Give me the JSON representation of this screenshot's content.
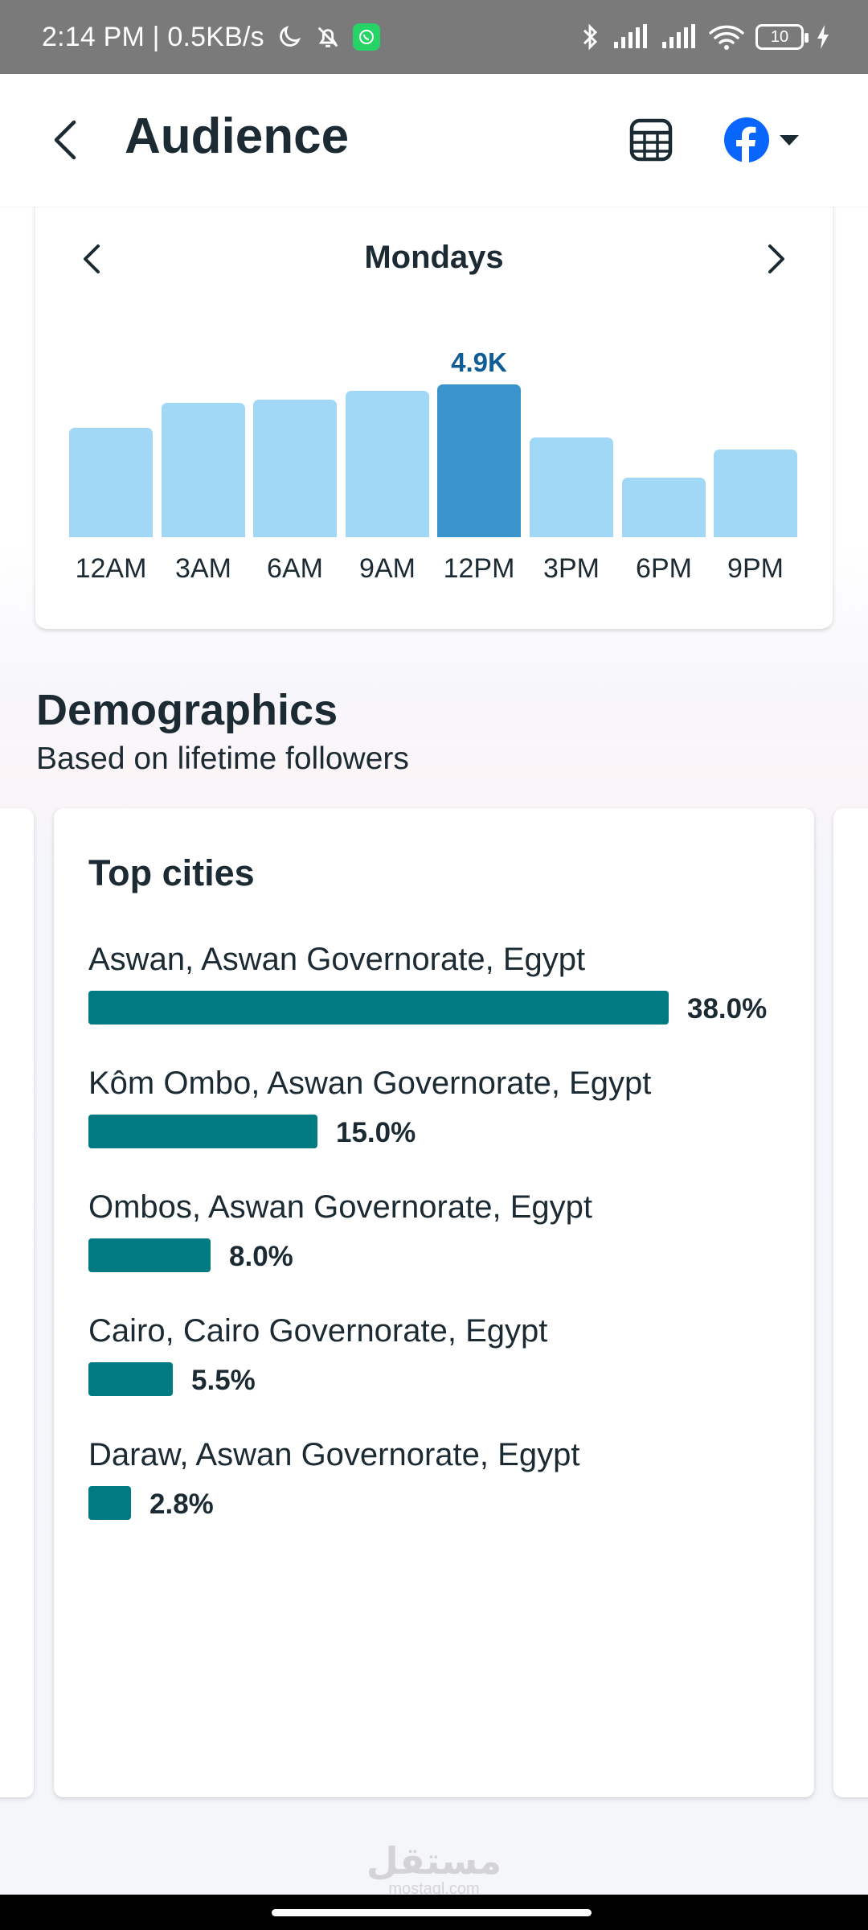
{
  "status_bar": {
    "time_and_speed": "2:14 PM | 0.5KB/s",
    "battery": "10"
  },
  "header": {
    "title": "Audience",
    "back_icon": "chevron-left-icon",
    "table_icon": "table-icon",
    "account_icon": "facebook-icon",
    "dropdown_icon": "caret-down-icon"
  },
  "active_times": {
    "day": "Mondays",
    "peak_value_label": "4.9K",
    "chart_data": {
      "type": "bar",
      "categories": [
        "12AM",
        "3AM",
        "6AM",
        "9AM",
        "12PM",
        "3PM",
        "6PM",
        "9PM"
      ],
      "values": [
        3.5,
        4.3,
        4.4,
        4.7,
        4.9,
        3.2,
        1.9,
        2.8
      ],
      "highlighted_category": "12PM",
      "highlight_color": "#3b95cc",
      "bar_color": "#a1d8f6",
      "ylim": [
        0,
        4.9
      ]
    }
  },
  "demographics": {
    "title": "Demographics",
    "subtitle": "Based on lifetime followers",
    "top_cities": {
      "title": "Top cities",
      "bar_color": "#017a82",
      "items": [
        {
          "name": "Aswan, Aswan Governorate, Egypt",
          "percent": 38.0,
          "percent_label": "38.0%"
        },
        {
          "name": "Kôm Ombo, Aswan Governorate, Egypt",
          "percent": 15.0,
          "percent_label": "15.0%"
        },
        {
          "name": "Ombos, Aswan Governorate, Egypt",
          "percent": 8.0,
          "percent_label": "8.0%"
        },
        {
          "name": "Cairo, Cairo Governorate, Egypt",
          "percent": 5.5,
          "percent_label": "5.5%"
        },
        {
          "name": "Daraw, Aswan Governorate, Egypt",
          "percent": 2.8,
          "percent_label": "2.8%"
        }
      ]
    }
  },
  "watermark": {
    "arabic": "مستقل",
    "latin": "mostaql.com"
  }
}
